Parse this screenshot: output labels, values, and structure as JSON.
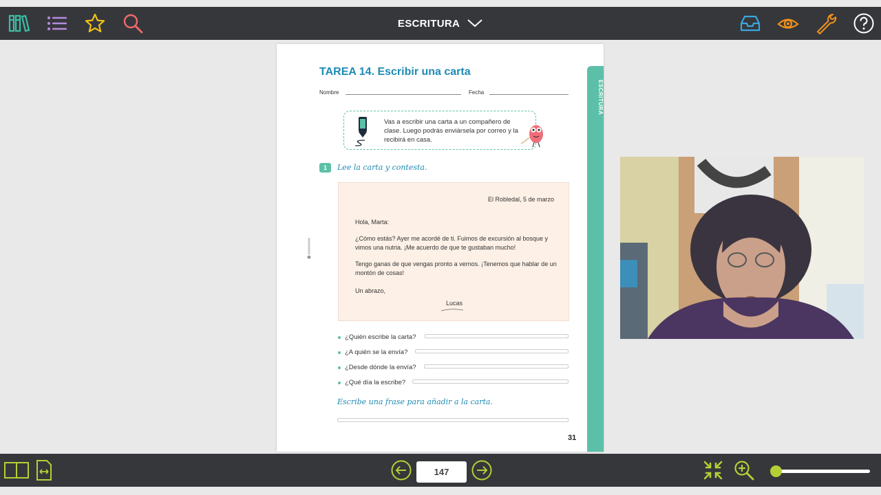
{
  "toolbar": {
    "section_title": "ESCRITURA",
    "icons": [
      "library-icon",
      "index-list-icon",
      "favorites-star-icon",
      "search-icon",
      "inbox-icon",
      "visibility-eye-icon",
      "tools-wrench-icon",
      "help-icon"
    ]
  },
  "page": {
    "side_tab_label": "ESCRITURA",
    "task_title": "TAREA 14. Escribir una carta",
    "name_label": "Nombre",
    "date_label": "Fecha",
    "bubble_text": "Vas a escribir una carta a un compañero de clase. Luego podrás enviársela por correo y la recibirá en casa.",
    "exercise_number": "1",
    "exercise_instruction": "Lee la carta y contesta.",
    "letter": {
      "date": "El Robledal, 5 de marzo",
      "greeting": "Hola, Marta:",
      "paragraph1": "¿Cómo estás? Ayer me acordé de ti. Fuimos de excursión al bosque y vimos una nutria. ¡Me acuerdo de que te gustaban mucho!",
      "paragraph2": "Tengo ganas de que vengas pronto a vernos. ¡Tenemos que hablar de un montón de cosas!",
      "closing": "Un abrazo,",
      "signature": "Lucas"
    },
    "questions": [
      "¿Quién escribe la carta?",
      "¿A quién se la envía?",
      "¿Desde dónde la envía?",
      "¿Qué día la escribe?"
    ],
    "write_instruction": "Escribe una frase para añadir a la carta.",
    "page_number": "31"
  },
  "bottombar": {
    "current_page": "147",
    "zoom_level": 0.05
  },
  "colors": {
    "toolbar_bg": "#36373b",
    "accent_green": "#b5d034",
    "title_blue": "#1e8bb5",
    "teal": "#5cc0a8"
  }
}
